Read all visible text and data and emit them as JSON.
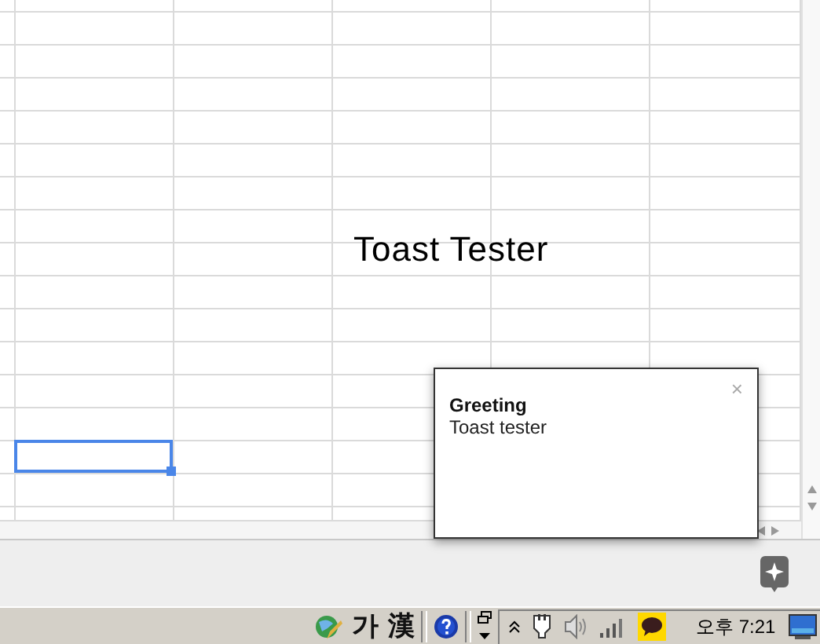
{
  "sheet": {
    "heading": "Toast Tester"
  },
  "toast": {
    "title": "Greeting",
    "message": "Toast tester",
    "close": "×"
  },
  "taskbar": {
    "ime": [
      "가",
      "漢"
    ],
    "clock": "오후 7:21"
  }
}
